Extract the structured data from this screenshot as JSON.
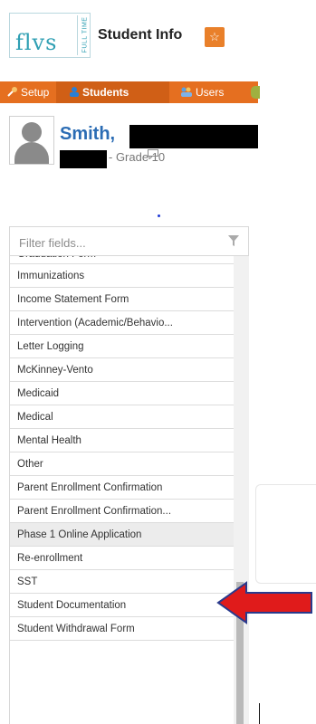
{
  "header": {
    "logo_text": "flvs",
    "logo_sub": "FULL TIME",
    "app_title": "Student Info",
    "star_glyph": "☆"
  },
  "nav": {
    "items": [
      {
        "label": "Setup",
        "icon": "wrench-icon",
        "active": false
      },
      {
        "label": "Students",
        "icon": "student-icon",
        "active": true
      },
      {
        "label": "Users",
        "icon": "users-icon",
        "active": false
      }
    ]
  },
  "student": {
    "last_name": "Smith,",
    "grade": "- Grade 10"
  },
  "filter": {
    "placeholder": "Filter fields..."
  },
  "fields": {
    "partial": "Graduation Form",
    "items": [
      "Immunizations",
      "Income Statement Form",
      "Intervention (Academic/Behavio...",
      "Letter Logging",
      "McKinney-Vento",
      "Medicaid",
      "Medical",
      "Mental Health",
      "Other",
      "Parent Enrollment Confirmation",
      "Parent Enrollment Confirmation...",
      "Phase 1 Online Application",
      "Re-enrollment",
      "SST",
      "Student Documentation",
      "Student Withdrawal Form"
    ],
    "selected_index": 11
  },
  "colors": {
    "nav_orange": "#e56f20",
    "name_blue": "#2b6cb4",
    "arrow_red": "#e01b1b",
    "arrow_outline": "#2a3a8c"
  }
}
